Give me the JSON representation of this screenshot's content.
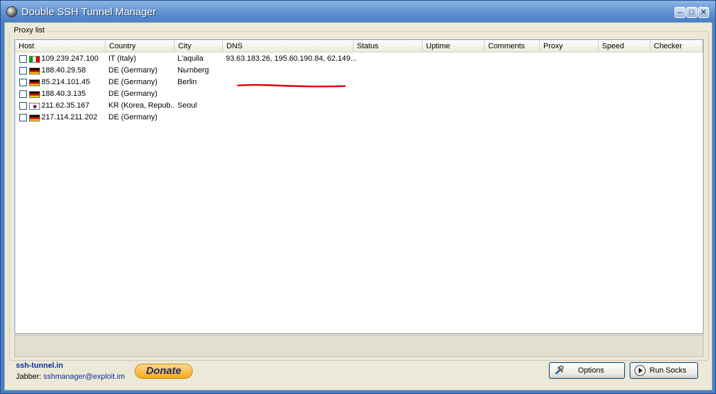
{
  "window": {
    "title": "Double SSH Tunnel Manager",
    "minimize_glyph": "–",
    "maximize_glyph": "□",
    "close_glyph": "✕"
  },
  "proxy_list": {
    "group_label": "Proxy list",
    "columns": [
      "Host",
      "Country",
      "City",
      "DNS",
      "Status",
      "Uptime",
      "Comments",
      "Proxy",
      "Speed",
      "Checker"
    ],
    "rows": [
      {
        "flag": "italy-flag-icon",
        "host": "109.239.247.100",
        "country": "IT (Italy)",
        "city": "L'aquila",
        "dns": "93.63.183.26, 195.60.190.84, 62.149..."
      },
      {
        "flag": "germany-flag-icon",
        "host": "188.40.29.58",
        "country": "DE (Germany)",
        "city": "Nьrnberg",
        "dns": ""
      },
      {
        "flag": "germany-flag-icon",
        "host": "85.214.101.45",
        "country": "DE (Germany)",
        "city": "Berlin",
        "dns": ""
      },
      {
        "flag": "germany-flag-icon",
        "host": "188.40.3.135",
        "country": "DE (Germany)",
        "city": "",
        "dns": ""
      },
      {
        "flag": "korea-flag-icon",
        "host": "211.62.35.167",
        "country": "KR (Korea, Repub...",
        "city": "Seoul",
        "dns": ""
      },
      {
        "flag": "germany-flag-icon",
        "host": "217.114.211.202",
        "country": "DE (Germany)",
        "city": "",
        "dns": ""
      }
    ]
  },
  "footer": {
    "site_link": "ssh-tunnel.in",
    "jabber_label": "Jabber:",
    "jabber_address": "sshmanager@exploit.im",
    "donate_label": "Donate",
    "options_label": "Options",
    "run_socks_label": "Run Socks"
  },
  "colors": {
    "title_bar": "#5c8fd1",
    "window_bg": "#ece9d8",
    "link": "#0b2f9e",
    "annotation_underline": "#e00000"
  }
}
